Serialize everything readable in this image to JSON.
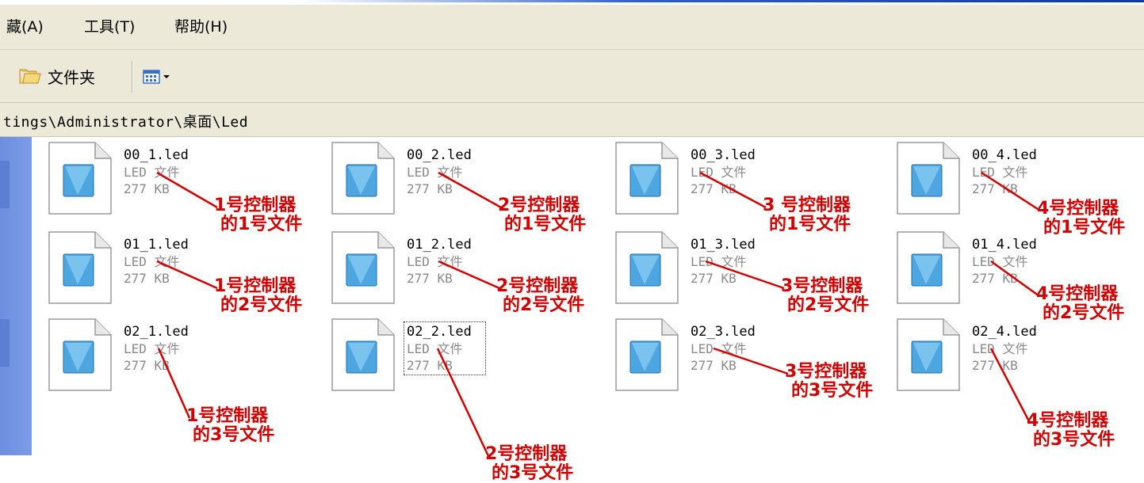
{
  "menu": {
    "favorites": "藏(A)",
    "tools": "工具(T)",
    "help": "帮助(H)"
  },
  "toolbar": {
    "folders_label": "文件夹",
    "folders_icon": "folder-icon",
    "views_icon": "views-icon"
  },
  "address": {
    "path": "tings\\Administrator\\桌面\\Led"
  },
  "files": [
    {
      "name": "00_1.led",
      "type": "LED 文件",
      "size": "277 KB",
      "annotation": [
        "1号控制器",
        "的1号文件"
      ]
    },
    {
      "name": "00_2.led",
      "type": "LED 文件",
      "size": "277 KB",
      "annotation": [
        "2号控制器",
        "的1号文件"
      ]
    },
    {
      "name": "00_3.led",
      "type": "LED 文件",
      "size": "277 KB",
      "annotation": [
        "3 号控制器",
        "的1号文件"
      ]
    },
    {
      "name": "00_4.led",
      "type": "LED 文件",
      "size": "277 KB",
      "annotation": [
        "4号控制器",
        "的1号文件"
      ]
    },
    {
      "name": "01_1.led",
      "type": "LED 文件",
      "size": "277 KB",
      "annotation": [
        "1号控制器",
        "的2号文件"
      ]
    },
    {
      "name": "01_2.led",
      "type": "LED 文件",
      "size": "277 KB",
      "annotation": [
        "2号控制器",
        "的2号文件"
      ]
    },
    {
      "name": "01_3.led",
      "type": "LED 文件",
      "size": "277 KB",
      "annotation": [
        "3号控制器",
        "的2号文件"
      ]
    },
    {
      "name": "01_4.led",
      "type": "LED 文件",
      "size": "277 KB",
      "annotation": [
        "4号控制器",
        "的2号文件"
      ]
    },
    {
      "name": "02_1.led",
      "type": "LED 文件",
      "size": "277 KB",
      "annotation": [
        "1号控制器",
        "的3号文件"
      ]
    },
    {
      "name": "02_2.led",
      "type": "LED 文件",
      "size": "277 KB",
      "annotation": [
        "2号控制器",
        "的3号文件"
      ],
      "selected": true
    },
    {
      "name": "02_3.led",
      "type": "LED 文件",
      "size": "277 KB",
      "annotation": [
        "3号控制器",
        "的3号文件"
      ]
    },
    {
      "name": "02_4.led",
      "type": "LED 文件",
      "size": "277 KB",
      "annotation": [
        "4号控制器",
        "的3号文件"
      ]
    }
  ],
  "colors": {
    "chrome": "#ece9d8",
    "annotation": "#d40000",
    "leftpanel": "#7b9be6",
    "secondary_text": "#8a8a8a"
  }
}
